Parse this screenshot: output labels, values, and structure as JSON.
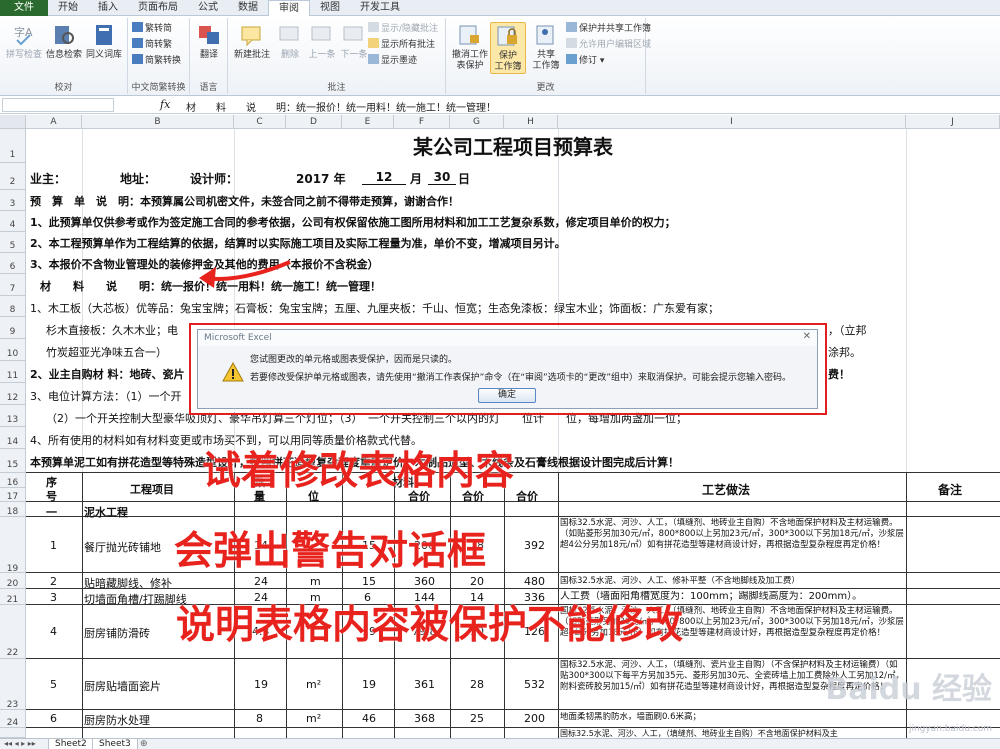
{
  "ribbon": {
    "tabs": [
      "文件",
      "开始",
      "插入",
      "页面布局",
      "公式",
      "数据",
      "审阅",
      "视图",
      "开发工具"
    ],
    "active_tab": "审阅",
    "groups": {
      "proofing": {
        "label": "校对",
        "spell": "拼写检查",
        "research": "信息检索",
        "thesaurus": "同义词库"
      },
      "chinese": {
        "label": "中文简繁转换",
        "to_trad": "繁转简",
        "to_simp": "简转繁",
        "convert": "简繁转换"
      },
      "language": {
        "label": "语言",
        "translate": "翻译"
      },
      "comments": {
        "label": "批注",
        "new": "新建批注",
        "delete": "删除",
        "prev": "上一条",
        "next": "下一条",
        "show_hide": "显示/隐藏批注",
        "show_all": "显示所有批注",
        "show_ink": "显示墨迹"
      },
      "changes": {
        "label": "更改",
        "unprotect1": "撤消工作",
        "unprotect2": "表保护",
        "protect1": "保护",
        "protect2": "工作簿",
        "share1": "共享",
        "share2": "工作簿",
        "protect_share": "保护并共享工作簿",
        "allow_edit": "允许用户编辑区域",
        "track": "修订"
      }
    }
  },
  "formula_bar": {
    "fx": "fx",
    "content": "材　　料　　说　　明：统一报价！统一用料！统一施工！统一管理！"
  },
  "columns": [
    "A",
    "B",
    "C",
    "D",
    "E",
    "F",
    "G",
    "H",
    "I",
    "J"
  ],
  "rows": [
    "1",
    "2",
    "3",
    "4",
    "5",
    "6",
    "7",
    "8",
    "9",
    "10",
    "11",
    "12",
    "13",
    "14",
    "15",
    "16",
    "17",
    "18",
    "19",
    "20",
    "21",
    "22",
    "23",
    "24"
  ],
  "sheet": {
    "title": "某公司工程项目预算表",
    "r2": {
      "owner": "业主：",
      "address": "地址：",
      "designer": "设计师：",
      "year": "2017 年",
      "month_val": "12",
      "month": "月",
      "day_val": "30",
      "day": "日"
    },
    "r3": "预　算　单　说　明：本预算属公司机密文件，未签合同之前不得带走预算，谢谢合作！",
    "r4": "1、此预算单仅供参考或作为签定施工合同的参考依据，公司有权保留依施工图所用材料和加工工艺复杂系数，修定项目单价的权力；",
    "r5": "2、本工程预算单作为工程结算的依据，结算时以实际施工项目及实际工程量为准，单价不变，增减项目另计。",
    "r6": "3、本报价不含物业管理处的装修押金及其他的费用（本报价不含税金）",
    "r7": "材　　料　　说　　明：统一报价！统一用料！统一施工！统一管理！",
    "r8": "1、木工板（大芯板）优等品：兔宝宝牌；石膏板：兔宝宝牌；五厘、九厘夹板：千山、恒宽；生态免漆板：绿宝木业；饰面板：广东爱有家；",
    "r9a": "杉木直接板：久木木业；电",
    "r9b": "，（立邦",
    "r10a": "竹炭超亚光净味五合一）",
    "r10b": "涂邦。",
    "r11a": "2、业主自购材 料：地砖、瓷片",
    "r11b": "费！",
    "r12": "3、电位计算方法：（1）一个开",
    "r13": "（2）一个开关控制大型豪华吸顶灯、豪华吊灯算三个灯位；（3）　一个开关控制三个以内的灯　　位计　　位，每增加两盏加一位；",
    "r14": "4、所有使用的材料如有材料变更或市场买不到，可以用同等质量价格款式代替。",
    "r15": "本预算单泥工如有拼花造型等特殊造型设计，按照拼花造型复杂程度重新定价；木制品造型、木线条及石膏线根据设计图完成后计算！",
    "header": {
      "seq1": "序",
      "seq2": "号",
      "project": "工程项目",
      "qty1": "数",
      "qty2": "量",
      "unit": "位",
      "material": "材料",
      "price": "合价",
      "price2": "合价",
      "price3": "合价",
      "craft": "工艺做法",
      "remark": "备注"
    },
    "r18": {
      "seq": "一",
      "name": "泥水工程"
    },
    "items": [
      {
        "seq": "1",
        "name": "餐厅抛光砖铺地",
        "qty": "14",
        "unit": "",
        "price": "15",
        "total": "206",
        "labor": "28",
        "sum": "392",
        "note": "国标32.5水泥、河沙、人工，（填缝剂、地砖业主自购）不含地面保护材料及主材运输费。（如贴菱形另加30元/㎡，800*800以上另加23元/㎡，300*300以下另加18元/㎡，沙浆层超4公分另加18元/㎡）如有拼花造型等建材商设计好，再根据造型复杂程度再定价格！"
      },
      {
        "seq": "2",
        "name": "贴暗藏脚线、修补",
        "qty": "24",
        "unit": "m",
        "price": "15",
        "total": "360",
        "labor": "20",
        "sum": "480",
        "note": "国标32.5水泥、河沙、人工、修补平整（不含地脚线及加工费）"
      },
      {
        "seq": "3",
        "name": "切墙面角槽/打踢脚线",
        "qty": "24",
        "unit": "m",
        "price": "6",
        "total": "144",
        "labor": "14",
        "sum": "336",
        "note": "人工费（墙面阳角槽宽度为：100mm；踢脚线高度为：200mm）。"
      },
      {
        "seq": "4",
        "name": "厨房铺防滑砖",
        "qty": "4.3",
        "unit": "",
        "price": "19",
        "total": "79.8",
        "labor": "30",
        "sum": "126",
        "note": "国标32.5水泥、河沙、人工，（填缝剂、地砖业主自购）不含地面保护材料及主材运输费。（如贴菱形另加30元/㎡，800*800以上另加23元/㎡，300*300以下另加18元/㎡，沙浆层超4公分另加18元/㎡）如有拼花造型等建材商设计好，再根据造型复杂程度再定价格！"
      },
      {
        "seq": "5",
        "name": "厨房贴墙面瓷片",
        "qty": "19",
        "unit": "m²",
        "price": "19",
        "total": "361",
        "labor": "28",
        "sum": "532",
        "note": "国标32.5水泥、河沙、人工，（填缝剂、瓷片业主自购）（不含保护材料及主材运输费）（如贴300*300以下每平方另加35元、菱形另加30元、全瓷砖墙上加工费除外人工另加12/㎡，附料瓷砖胶另加15/㎡）如有拼花造型等建材商设计好，再根据造型复杂程度再定价格！"
      },
      {
        "seq": "6",
        "name": "厨房防水处理",
        "qty": "8",
        "unit": "m²",
        "price": "46",
        "total": "368",
        "labor": "25",
        "sum": "200",
        "note": "地面柔韧黑豹防水，墙面刷0.6米高；"
      }
    ],
    "r25_note": "国标32.5水泥、河沙、人工，（填缝剂、地砖业主自购）不含地面保护材料及主"
  },
  "dialog": {
    "title": "Microsoft Excel",
    "close": "✕",
    "msg1": "您试图更改的单元格或图表受保护，因而是只读的。",
    "msg2": "若要修改受保护单元格或图表，请先使用“撤消工作表保护”命令（在“审阅”选项卡的“更改”组中）来取消保护。可能会提示您输入密码。",
    "ok": "确定"
  },
  "annotations": {
    "line1": "试着修改表格内容",
    "line2": "会弹出警告对话框",
    "line3": "说明表格内容被保护不能修改"
  },
  "sheet_tabs": [
    "Sheet2",
    "Sheet3"
  ],
  "watermark": {
    "big": "Baidu 经验",
    "small": "jingyan.baidu.com"
  },
  "colors": {
    "accent_green": "#2a6a2e",
    "annotation_red": "#e8231e",
    "dialog_bg": "#f2f4f7"
  }
}
